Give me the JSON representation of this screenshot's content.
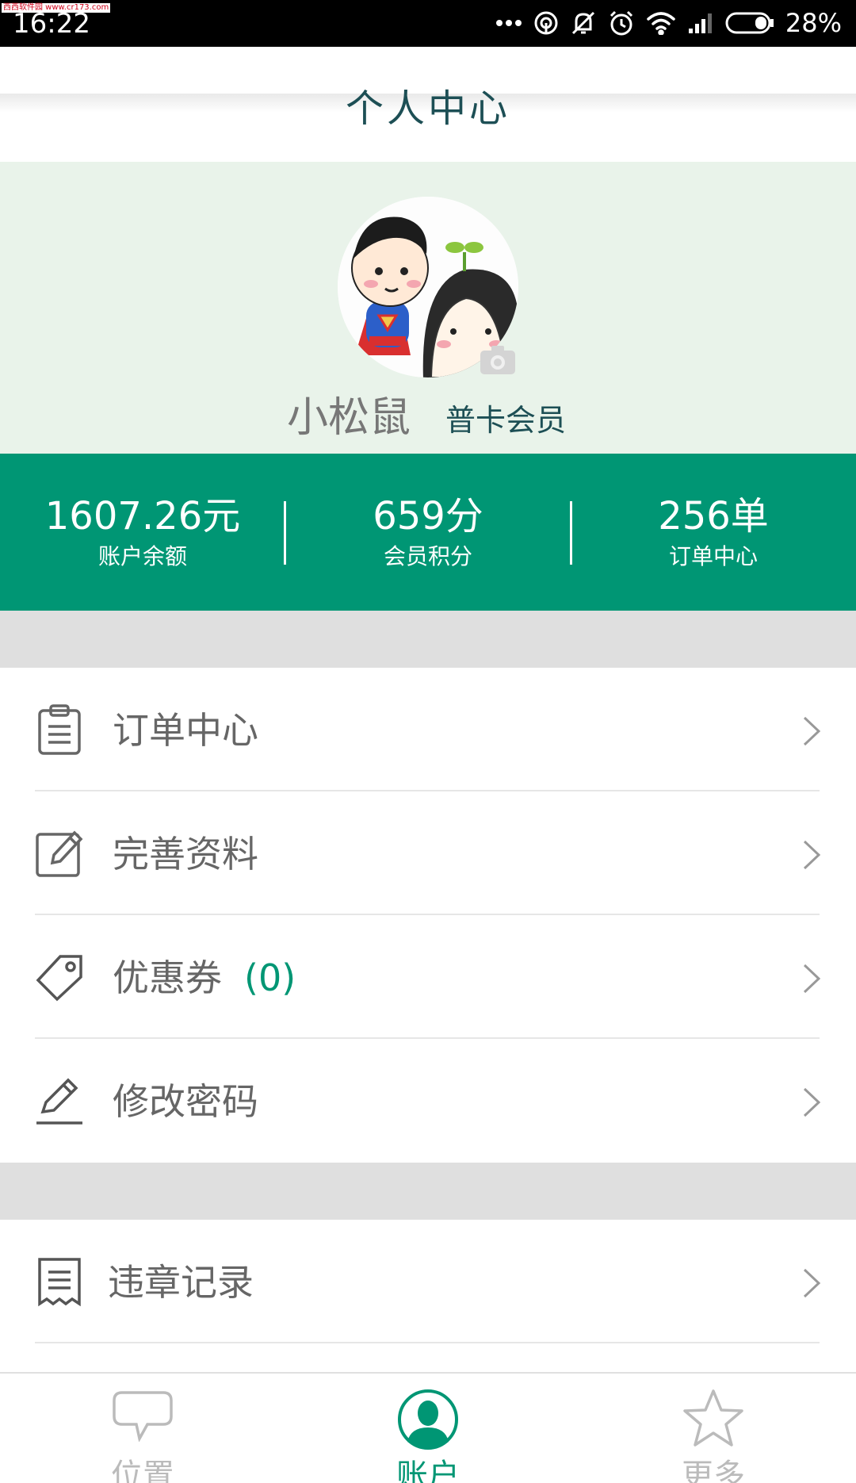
{
  "watermark": "西西软件园 www.cr173.com",
  "status_bar": {
    "time": "16:22",
    "battery_percent": "28%",
    "icons": [
      "more-dots-icon",
      "hotspot-icon",
      "mute-notification-icon",
      "alarm-icon",
      "wifi-icon",
      "signal-icon",
      "battery-icon"
    ]
  },
  "header": {
    "title": "个人中心"
  },
  "profile": {
    "name": "小松鼠",
    "member_level": "普卡会员",
    "avatar_icon": "cartoon-avatar",
    "camera_icon": "camera-icon"
  },
  "stats": [
    {
      "value": "1607.26元",
      "label": "账户余额"
    },
    {
      "value": "659分",
      "label": "会员积分"
    },
    {
      "value": "256单",
      "label": "订单中心"
    }
  ],
  "menu_group_1": [
    {
      "label": "订单中心",
      "icon": "clipboard-icon"
    },
    {
      "label": "完善资料",
      "icon": "edit-profile-icon"
    },
    {
      "label": "优惠券",
      "count": "(0)",
      "icon": "coupon-tag-icon"
    },
    {
      "label": "修改密码",
      "icon": "pencil-icon"
    }
  ],
  "menu_group_2": [
    {
      "label": "违章记录",
      "icon": "receipt-icon"
    }
  ],
  "bottom_nav": [
    {
      "label": "位置",
      "icon": "chat-bubble-icon",
      "active": false
    },
    {
      "label": "账户",
      "icon": "account-person-icon",
      "active": true
    },
    {
      "label": "更多",
      "icon": "star-icon",
      "active": false
    }
  ],
  "colors": {
    "accent": "#009674",
    "title_text": "#1d4f55",
    "profile_bg": "#e9f3ea",
    "separator_bg": "#dfdfdf"
  }
}
